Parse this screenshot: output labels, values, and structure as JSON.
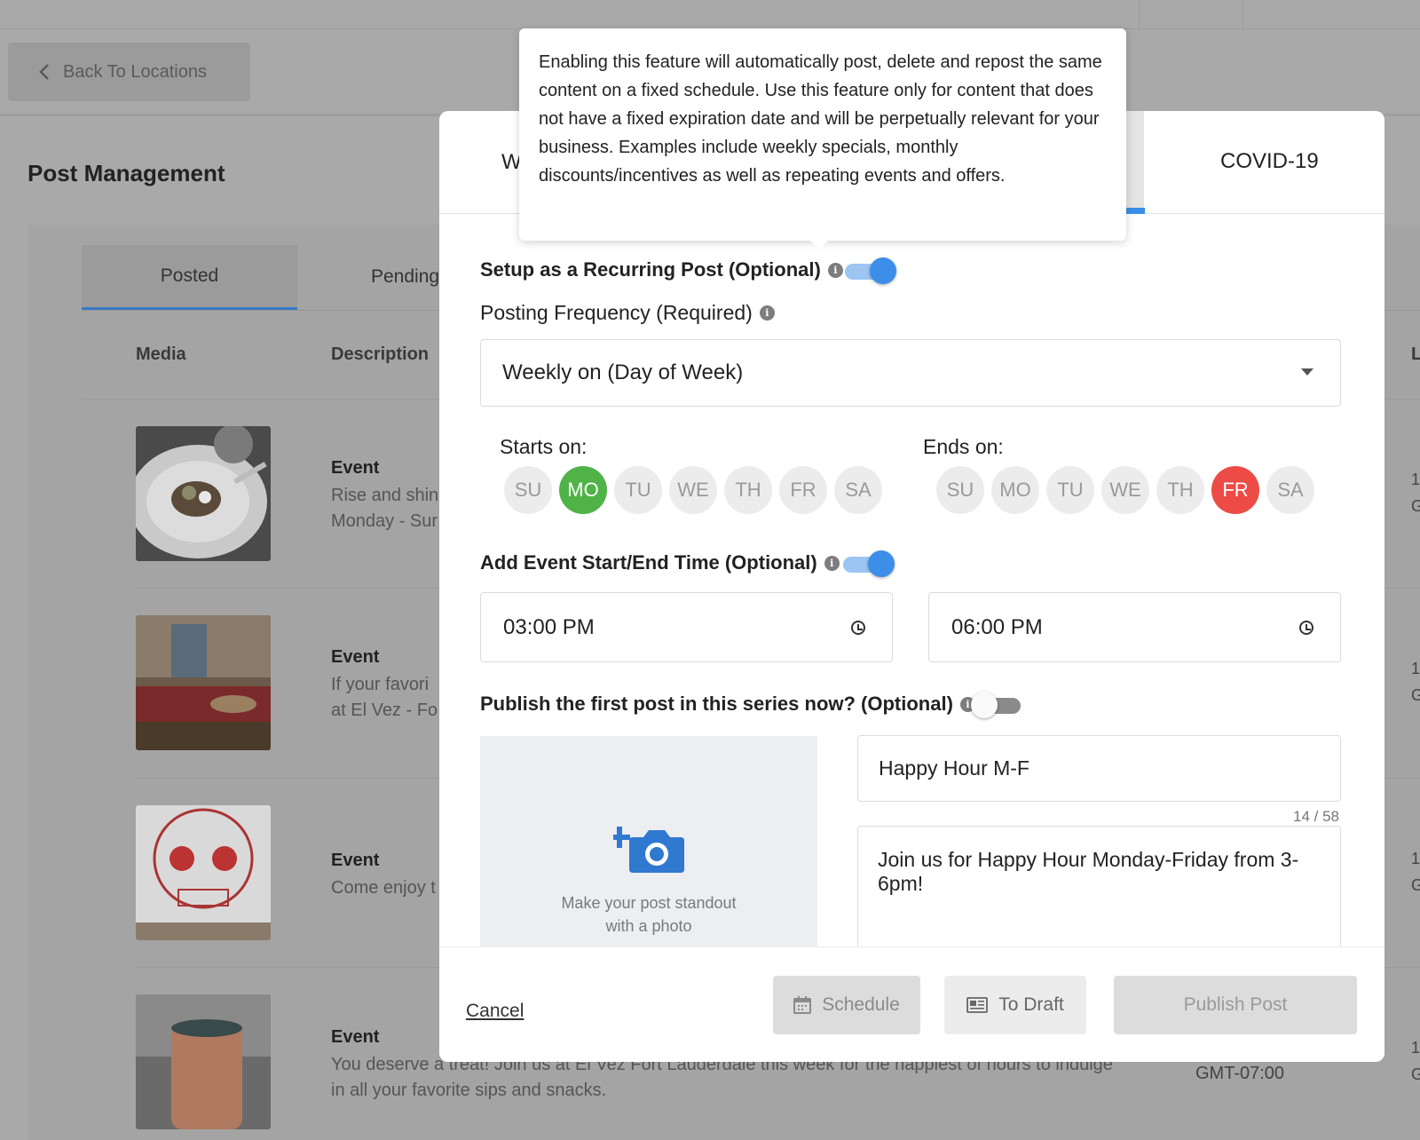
{
  "background": {
    "back_label": "Back To Locations",
    "page_title": "Post Management",
    "tabs": {
      "posted": "Posted",
      "pending": "Pending"
    },
    "columns": {
      "media": "Media",
      "description": "Description"
    },
    "rows": [
      {
        "type": "Event",
        "line1": "Rise and shin",
        "line2": "Monday - Sur"
      },
      {
        "type": "Event",
        "line1": "If your favori",
        "line2": "at El Vez - Fo"
      },
      {
        "type": "Event",
        "line1": "Come enjoy t",
        "line2": ""
      },
      {
        "type": "Event",
        "line1": "You deserve a treat! Join us at El Vez Fort Lauderdale this week for the happiest of hours to indulge",
        "line2": "in all your favorite sips and snacks."
      }
    ],
    "timezone": "GMT-07:00",
    "edge_col_header": "L",
    "edge_chars": [
      {
        "a": "1",
        "b": "G"
      },
      {
        "a": "1",
        "b": "G"
      },
      {
        "a": "1",
        "b": "G"
      },
      {
        "a": "1",
        "b": "G"
      }
    ]
  },
  "modal": {
    "tab_partial": "W",
    "tab_covid": "COVID-19",
    "recurring_label": "Setup as a Recurring Post (Optional)",
    "frequency_label": "Posting Frequency (Required)",
    "frequency_value": "Weekly on (Day of Week)",
    "starts_label": "Starts on:",
    "ends_label": "Ends on:",
    "days": [
      "SU",
      "MO",
      "TU",
      "WE",
      "TH",
      "FR",
      "SA"
    ],
    "starts_selected": "MO",
    "ends_selected": "FR",
    "event_time_label": "Add Event Start/End Time (Optional)",
    "start_time": "03:00  PM",
    "end_time": "06:00  PM",
    "publish_now_label": "Publish the first post in this series now? (Optional)",
    "photo_text_1": "Make your post standout",
    "photo_text_2": "with a photo",
    "title_value": "Happy Hour M-F",
    "title_counter": "14 / 58",
    "description_value": "Join us for Happy Hour Monday-Friday from 3-6pm!",
    "cancel_label": "Cancel",
    "schedule_label": "Schedule",
    "draft_label": "To Draft",
    "publish_label": "Publish Post"
  },
  "tooltip": {
    "text": "Enabling this feature will automatically post, delete and repost the same content on a fixed schedule. Use this feature only for content that does not have a fixed expiration date and will be perpetually relevant for your business. Examples include weekly specials, monthly discounts/incentives as well as repeating events and offers."
  },
  "colors": {
    "accent_blue": "#3d8ee8",
    "day_start_green": "#4fb347",
    "day_end_red": "#ec4b46"
  }
}
